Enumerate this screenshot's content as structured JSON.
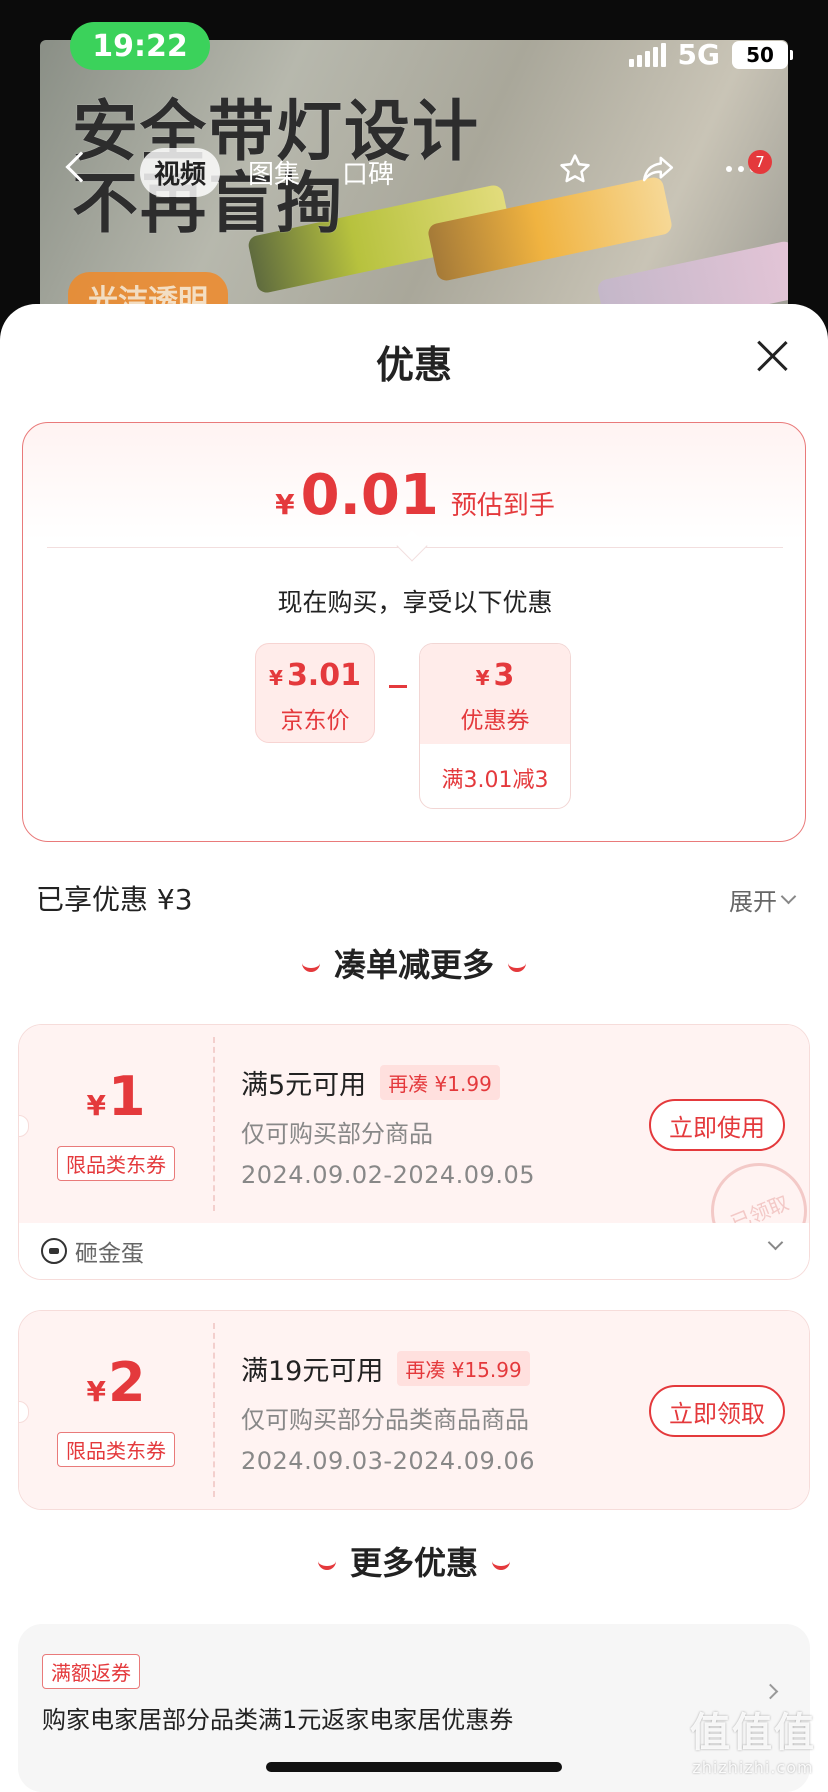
{
  "status_bar": {
    "time": "19:22",
    "network": "5G",
    "battery": "50"
  },
  "product_image": {
    "headline_line1": "安全带灯设计",
    "headline_line2": "不再盲掏",
    "badge": "光洁透明"
  },
  "nav": {
    "tabs": [
      {
        "label": "视频",
        "active": true
      },
      {
        "label": "图集",
        "active": false
      },
      {
        "label": "口碑",
        "active": false
      }
    ],
    "icons": [
      "back-icon",
      "star-icon",
      "share-icon",
      "more-icon"
    ],
    "notification_count": "7"
  },
  "sheet": {
    "title": "优惠",
    "summary": {
      "currency": "¥",
      "estimated_price": "0.01",
      "estimated_label": "预估到手",
      "buy_tip": "现在购买，享受以下优惠",
      "jd_price": {
        "currency": "¥",
        "value": "3.01",
        "label": "京东价"
      },
      "minus": "-",
      "coupon": {
        "currency": "¥",
        "value": "3",
        "label": "优惠券",
        "condition": "满3.01减3"
      }
    },
    "enjoyed": "已享优惠 ¥3",
    "expand_label": "展开",
    "section_more_savings": "凑单减更多",
    "coupons": [
      {
        "currency": "¥",
        "amount": "1",
        "tag": "限品类东券",
        "condition": "满5元可用",
        "more_needed": "再凑 ¥1.99",
        "description": "仅可购买部分商品",
        "date_range": "2024.09.02-2024.09.05",
        "button": "立即使用",
        "stamp": "已领取",
        "footer": "砸金蛋"
      },
      {
        "currency": "¥",
        "amount": "2",
        "tag": "限品类东券",
        "condition": "满19元可用",
        "more_needed": "再凑 ¥15.99",
        "description": "仅可购买部分品类商品商品",
        "date_range": "2024.09.03-2024.09.06",
        "button": "立即领取"
      }
    ],
    "section_more_offers": "更多优惠",
    "more_offer": {
      "tag": "满额返券",
      "text": "购家电家居部分品类满1元返家电家居优惠券"
    }
  },
  "watermark": {
    "logo": "值值值",
    "url": "zhizhizhi.com"
  },
  "colors": {
    "accent": "#e4393c",
    "status_green": "#3bd25b",
    "coupon_bg": "#fff3f2"
  }
}
